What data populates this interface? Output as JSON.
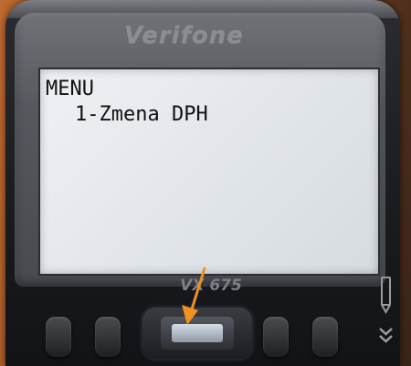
{
  "device": {
    "brand": "Verifone",
    "model": "VX 675"
  },
  "screen": {
    "title": "MENU",
    "menu_items": [
      {
        "label": "1-Zmena DPH"
      }
    ]
  },
  "colors": {
    "arrow": "#f0901e",
    "screen_bg": "#e6e9ed",
    "screen_text": "#111111",
    "device_body": "#1d1f23"
  },
  "icons": {
    "annotation": "arrow-icon",
    "side": [
      "pen-icon",
      "chevron-down-icon"
    ]
  }
}
